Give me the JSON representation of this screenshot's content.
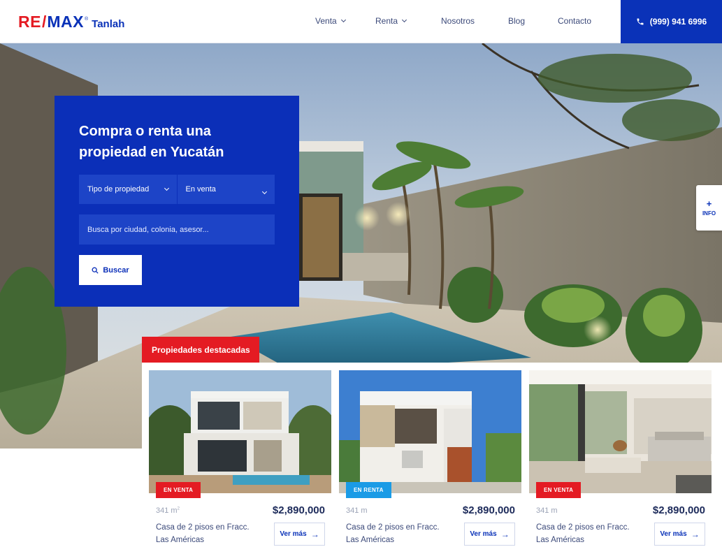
{
  "brand": {
    "re": "RE",
    "slash": "/",
    "max": "MAX",
    "reg": "®",
    "office": "Tanlah"
  },
  "nav": {
    "items": [
      {
        "label": "Venta",
        "dropdown": true
      },
      {
        "label": "Renta",
        "dropdown": true
      },
      {
        "label": "Nosotros",
        "dropdown": false
      },
      {
        "label": "Blog",
        "dropdown": false
      },
      {
        "label": "Contacto",
        "dropdown": false
      }
    ],
    "phone": "(999) 941 6996"
  },
  "hero": {
    "title": "Compra o renta una propiedad en Yucatán",
    "property_type": "Tipo de propiedad",
    "operation": "En venta",
    "search_placeholder": "Busca por ciudad, colonia, asesor...",
    "search_button": "Buscar"
  },
  "info_tab": {
    "plus": "+",
    "label": "INFO"
  },
  "featured": {
    "label": "Propiedades destacadas",
    "cards": [
      {
        "badge": "EN VENTA",
        "badge_color": "#e41b23",
        "area": "341 m",
        "area_unit_sup": "2",
        "price": "$2,890,000",
        "title": "Casa de 2 pisos en Fracc. Las Américas",
        "button": "Ver más"
      },
      {
        "badge": "EN RENTA",
        "badge_color": "#1a9be6",
        "area": "341 m",
        "area_unit_sup": "",
        "price": "$2,890,000",
        "title": "Casa de 2 pisos en Fracc. Las Américas",
        "button": "Ver más"
      },
      {
        "badge": "EN VENTA",
        "badge_color": "#e41b23",
        "area": "341 m",
        "area_unit_sup": "",
        "price": "$2,890,000",
        "title": "Casa de 2 pisos en Fracc. Las Américas",
        "button": "Ver más"
      }
    ]
  },
  "colors": {
    "brand_blue": "#0a32b8",
    "brand_red": "#e41b23",
    "rent_blue": "#1a9be6"
  }
}
